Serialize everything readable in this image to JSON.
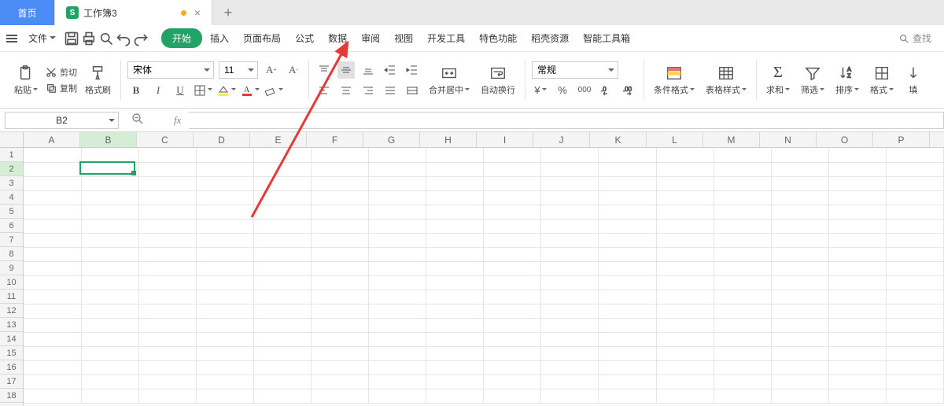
{
  "titlebar": {
    "home": "首页",
    "doc_icon": "S",
    "doc_name": "工作簿3",
    "new_tab": "+"
  },
  "menu": {
    "file": "文件",
    "tabs": [
      "开始",
      "插入",
      "页面布局",
      "公式",
      "数据",
      "审阅",
      "视图",
      "开发工具",
      "特色功能",
      "稻壳资源",
      "智能工具箱"
    ],
    "active_index": 0,
    "search": "查找"
  },
  "ribbon": {
    "paste": "粘贴",
    "cut": "剪切",
    "copy": "复制",
    "format_painter": "格式刷",
    "font_name": "宋体",
    "font_size": "11",
    "merge_center": "合并居中",
    "wrap": "自动换行",
    "number_format": "常规",
    "cond_format": "条件格式",
    "table_style": "表格样式",
    "sum": "求和",
    "filter": "筛选",
    "sort": "排序",
    "format": "格式",
    "fill": "填"
  },
  "formula_bar": {
    "cell_ref": "B2",
    "fx": "fx",
    "value": ""
  },
  "sheet": {
    "columns": [
      "A",
      "B",
      "C",
      "D",
      "E",
      "F",
      "G",
      "H",
      "I",
      "J",
      "K",
      "L",
      "M",
      "N",
      "O",
      "P"
    ],
    "rows_visible": 18,
    "selected": {
      "col": "B",
      "row": 2,
      "col_index": 1,
      "row_index": 1
    }
  }
}
